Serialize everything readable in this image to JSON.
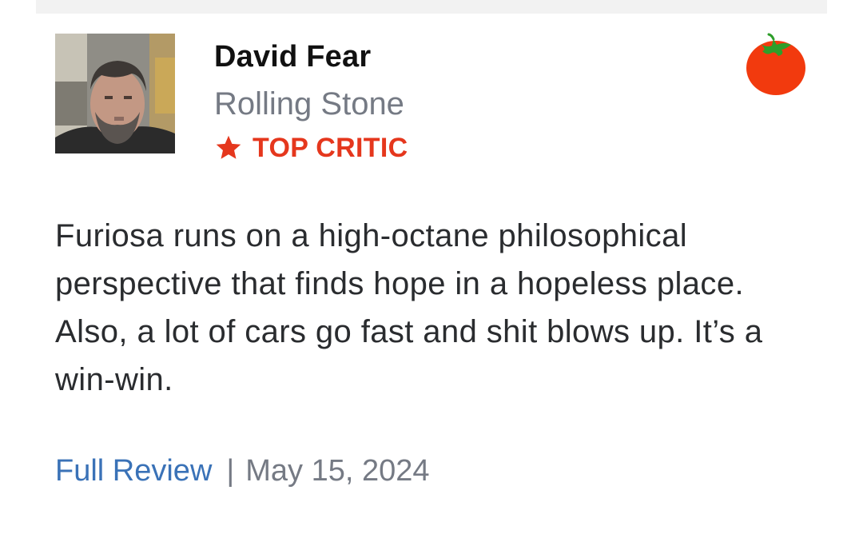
{
  "review": {
    "critic_name": "David Fear",
    "publication": "Rolling Stone",
    "top_critic_label": "TOP CRITIC",
    "quote": "Furiosa runs on a high-octane philosophical perspective that finds hope in a hopeless place. Also, a lot of cars go fast and shit blows up. It’s a win-win.",
    "link_label": "Full Review",
    "separator": "|",
    "date": "May 15, 2024",
    "score_icon": "fresh-tomato-icon",
    "badge_icon": "star-icon"
  },
  "colors": {
    "accent_red": "#e5371d",
    "link_blue": "#3a72b7",
    "muted_gray": "#757a84",
    "tomato_red": "#f23a0e",
    "tomato_leaf": "#2e9e2a"
  }
}
